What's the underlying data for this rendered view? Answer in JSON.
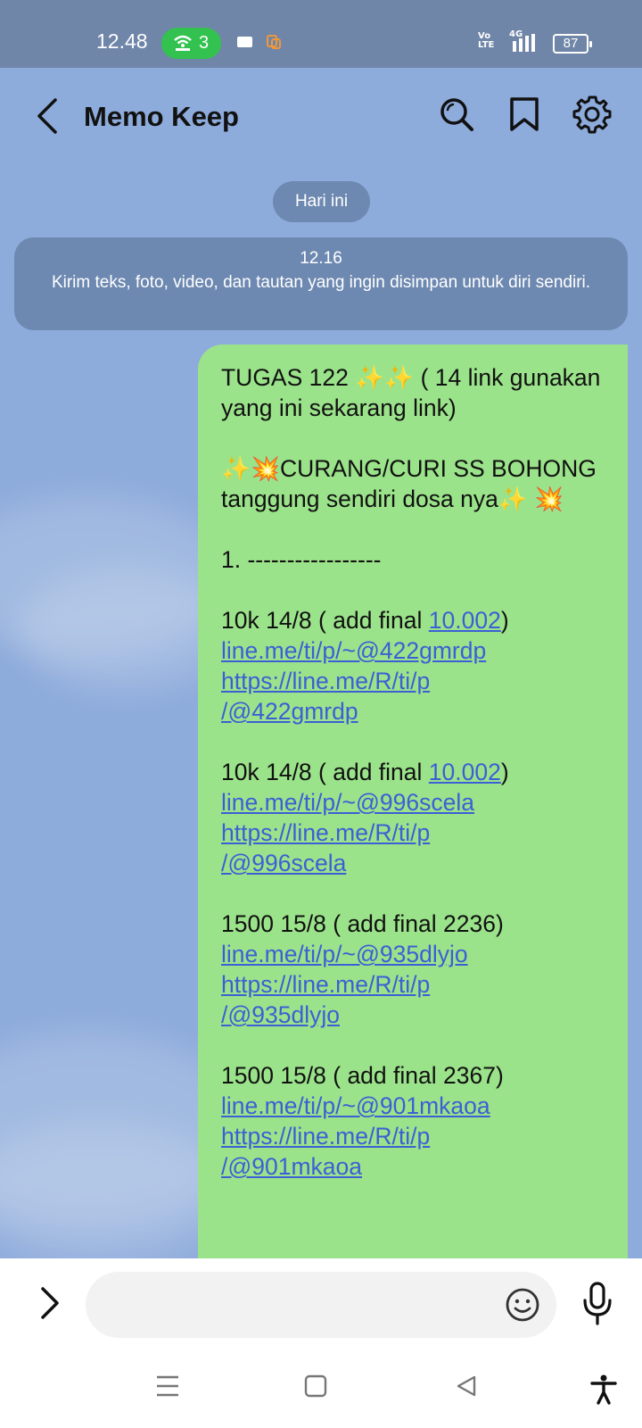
{
  "status_bar": {
    "time": "12.48",
    "hotspot_count": "3",
    "network_volte_top": "Vo",
    "network_volte_bottom": "LTE",
    "network_type": "4G",
    "battery": "87"
  },
  "header": {
    "title": "Memo Keep",
    "icons": [
      "back-icon",
      "search-icon",
      "bookmark-icon",
      "gear-icon"
    ]
  },
  "date_chip": "Hari ini",
  "notice": {
    "time": "12.16",
    "text": "Kirim teks, foto, video, dan tautan yang ingin disimpan untuk diri sendiri."
  },
  "message": {
    "line1": "TUGAS 122 ✨✨ ( 14 link gunakan yang ini sekarang link)",
    "line2": "✨💥CURANG/CURI SS BOHONG tanggung sendiri dosa nya✨ 💥",
    "line3": "1. -----------------",
    "entries": [
      {
        "prefix": "10k 14/8 ( add final ",
        "final": "10.002",
        "suffix": ")",
        "short_link": "line.me/ti/p/~@422gmrdp",
        "long_link_1": "https://line.me/R/ti/p",
        "long_link_2": "/@422gmrdp"
      },
      {
        "prefix": "10k 14/8 ( add final ",
        "final": "10.002",
        "suffix": ")",
        "short_link": "line.me/ti/p/~@996scela",
        "long_link_1": "https://line.me/R/ti/p",
        "long_link_2": "/@996scela"
      },
      {
        "prefix": "1500 15/8 ( add final 2236)",
        "final": "",
        "suffix": "",
        "short_link": "line.me/ti/p/~@935dlyjo",
        "long_link_1": "https://line.me/R/ti/p",
        "long_link_2": "/@935dlyjo"
      },
      {
        "prefix": "1500 15/8 ( add final 2367)",
        "final": "",
        "suffix": "",
        "short_link": "line.me/ti/p/~@901mkaoa",
        "long_link_1": "https://line.me/R/ti/p",
        "long_link_2": "/@901mkaoa"
      }
    ]
  },
  "input_bar": {
    "placeholder": "",
    "icons": [
      "chevron-right-icon",
      "emoji-icon",
      "microphone-icon"
    ]
  },
  "nav_bar": {
    "icons": [
      "menu-icon",
      "home-icon",
      "back-triangle-icon",
      "accessibility-icon"
    ]
  },
  "colors": {
    "chat_background": "#8dabdb",
    "bubble": "#9be38a",
    "link": "#3c5fd6",
    "status_bar": "#6f86a8"
  }
}
